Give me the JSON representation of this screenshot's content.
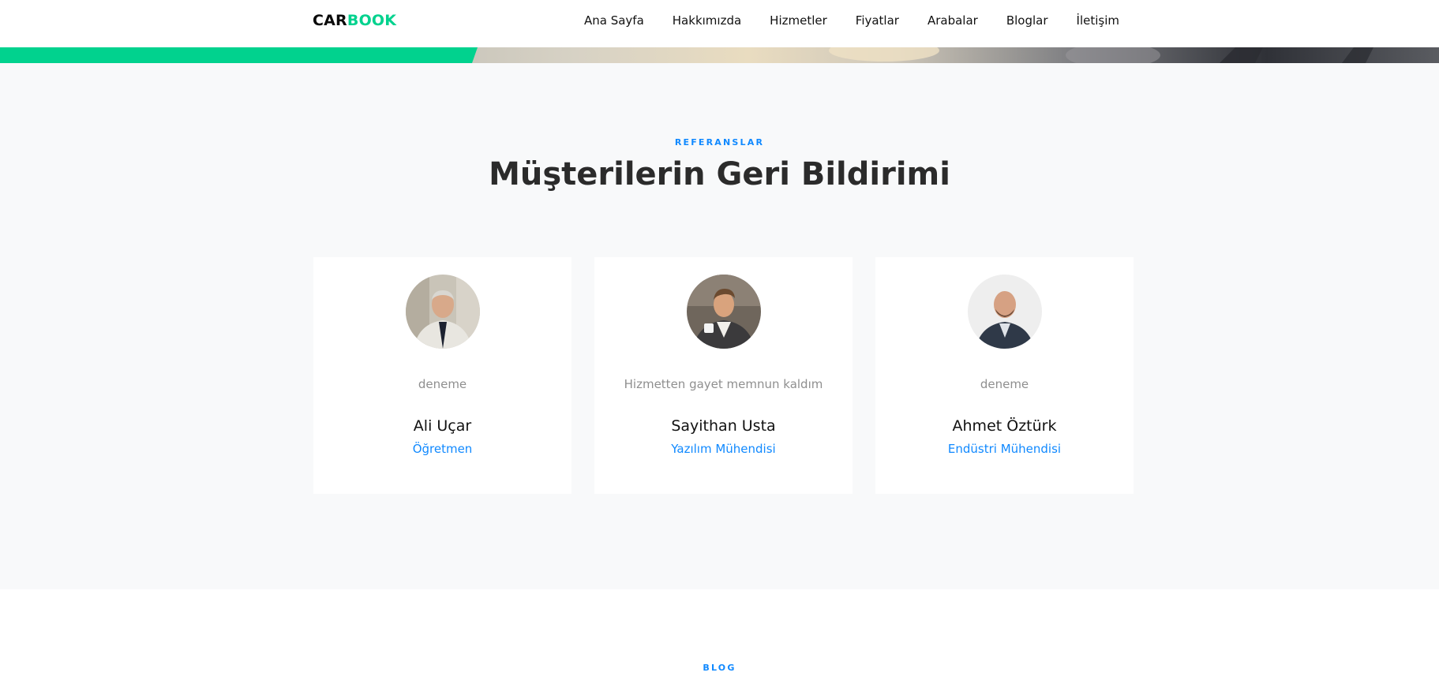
{
  "header": {
    "logo_part1": "CAR",
    "logo_part2": "BOOK",
    "nav": [
      {
        "label": "Ana Sayfa"
      },
      {
        "label": "Hakkımızda"
      },
      {
        "label": "Hizmetler"
      },
      {
        "label": "Fiyatlar"
      },
      {
        "label": "Arabalar"
      },
      {
        "label": "Bloglar"
      },
      {
        "label": "İletişim"
      }
    ]
  },
  "testimonials": {
    "eyebrow": "REFERANSLAR",
    "title": "Müşterilerin Geri Bildirimi",
    "items": [
      {
        "quote": "deneme",
        "name": "Ali Uçar",
        "role": "Öğretmen"
      },
      {
        "quote": "Hizmetten gayet memnun kaldım",
        "name": "Sayithan Usta",
        "role": "Yazılım Mühendisi"
      },
      {
        "quote": "deneme",
        "name": "Ahmet Öztürk",
        "role": "Endüstri Mühendisi"
      }
    ]
  },
  "blog": {
    "eyebrow": "BLOG"
  },
  "colors": {
    "brand_green": "#01d28e",
    "accent_blue": "#1089ff",
    "section_bg": "#f8f9fa"
  }
}
